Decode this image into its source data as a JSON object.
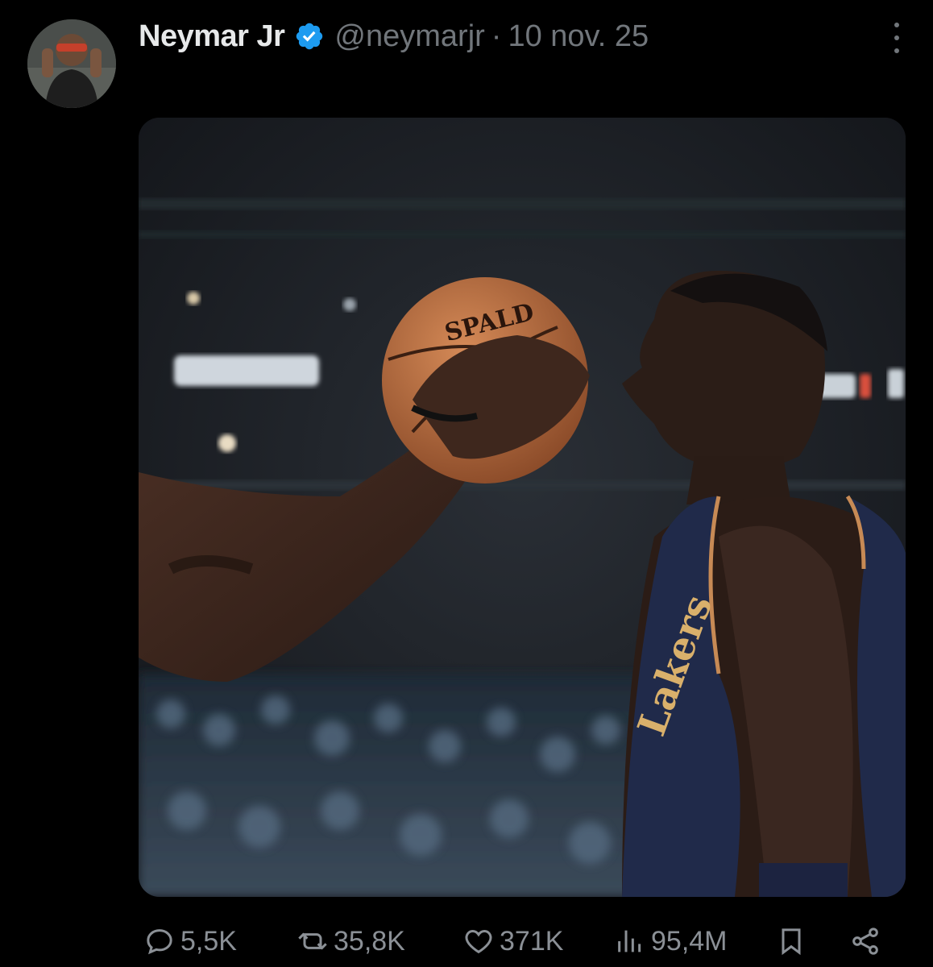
{
  "author": {
    "display_name": "Neymar Jr",
    "handle": "@neymarjr",
    "separator": "·",
    "date": "10 nov. 25",
    "verified": true,
    "avatar_icon": "avatar-photo"
  },
  "media": {
    "ball_brand_text": "SPALD"
  },
  "actions": {
    "replies": "5,5K",
    "retweets": "35,8K",
    "likes": "371K",
    "views": "95,4M"
  },
  "icons": {
    "reply": "reply-icon",
    "retweet": "retweet-icon",
    "like": "heart-icon",
    "views": "views-chart-icon",
    "bookmark": "bookmark-icon",
    "share": "share-icon",
    "more": "more-vertical-icon",
    "verified": "verified-badge-icon"
  },
  "colors": {
    "background": "#000000",
    "name": "#e7e9ea",
    "secondary": "#71767b",
    "verified": "#1d9bf0"
  }
}
